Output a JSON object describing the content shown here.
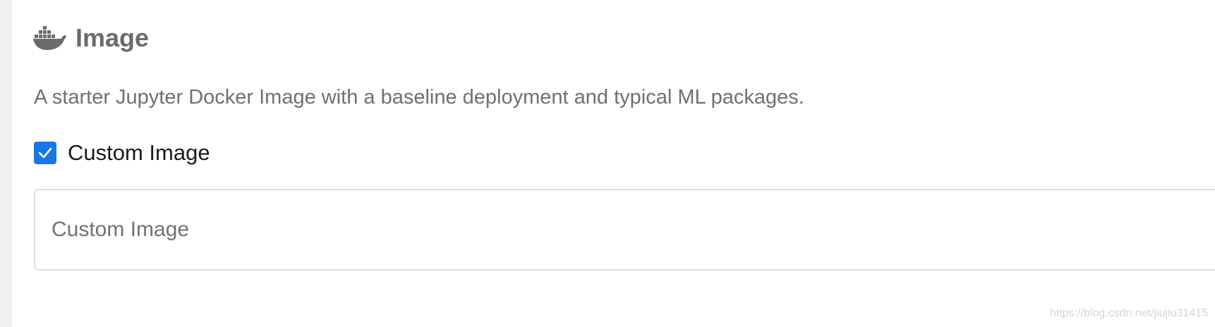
{
  "section": {
    "icon": "docker-whale-icon",
    "title": "Image",
    "description": "A starter Jupyter Docker Image with a baseline deployment and typical ML packages."
  },
  "custom_image": {
    "checkbox_checked": true,
    "checkbox_label": "Custom Image",
    "input_placeholder": "Custom Image",
    "input_value": ""
  },
  "watermark": "https://blog.csdn.net/jiujiu31415",
  "colors": {
    "accent": "#1677e6",
    "title": "#6b6b6b",
    "description": "#707070",
    "border": "#dcdfe3"
  }
}
